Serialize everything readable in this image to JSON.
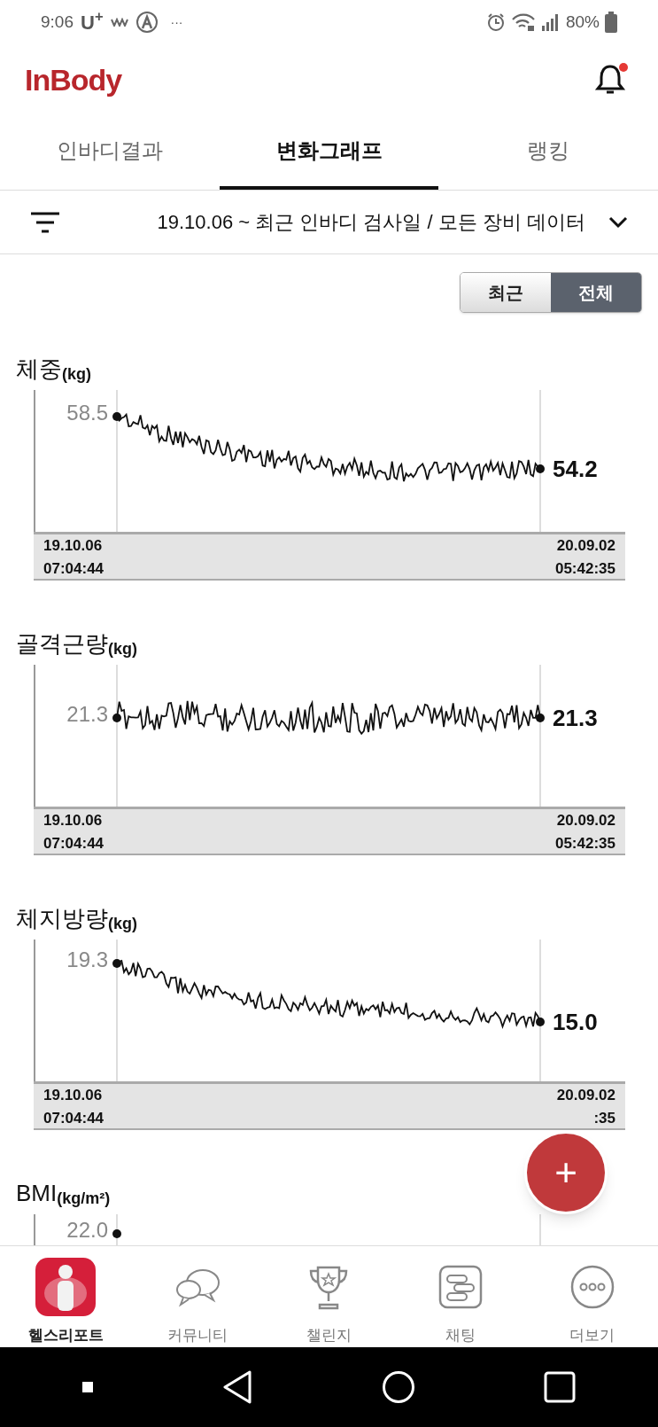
{
  "status_bar": {
    "time": "9:06",
    "carrier": "U$^{+}$",
    "more": "···",
    "battery": "80%"
  },
  "header": {
    "logo": "InBody",
    "has_new_notification": true
  },
  "tabs": [
    {
      "label": "인바디결과",
      "selected": false
    },
    {
      "label": "변화그래프",
      "selected": true
    },
    {
      "label": "랭킹",
      "selected": false
    }
  ],
  "filter": {
    "text": "19.10.06 ~ 최근 인바디 검사일 / 모든 장비 데이터"
  },
  "range_toggle": [
    {
      "label": "최근",
      "selected": false
    },
    {
      "label": "전체",
      "selected": true
    }
  ],
  "charts": [
    {
      "title": "체중",
      "unit": "(kg)",
      "start_value": "58.5",
      "end_value": "54.2",
      "start_date": "19.10.06",
      "start_time": "07:04:44",
      "end_date": "20.09.02",
      "end_time": "05:42:35"
    },
    {
      "title": "골격근량",
      "unit": "(kg)",
      "start_value": "21.3",
      "end_value": "21.3",
      "start_date": "19.10.06",
      "start_time": "07:04:44",
      "end_date": "20.09.02",
      "end_time": "05:42:35"
    },
    {
      "title": "체지방량",
      "unit": "(kg)",
      "start_value": "19.3",
      "end_value": "15.0",
      "start_date": "19.10.06",
      "start_time": "07:04:44",
      "end_date": "20.09.02",
      "end_time": ":35"
    },
    {
      "title": "BMI",
      "unit": "(kg/m²)",
      "start_value": "22.0"
    }
  ],
  "fab": {
    "label": "+"
  },
  "bottom_nav": [
    {
      "label": "헬스리포트",
      "selected": true
    },
    {
      "label": "커뮤니티",
      "selected": false
    },
    {
      "label": "챌린지",
      "selected": false
    },
    {
      "label": "채팅",
      "selected": false
    },
    {
      "label": "더보기",
      "selected": false
    }
  ]
}
